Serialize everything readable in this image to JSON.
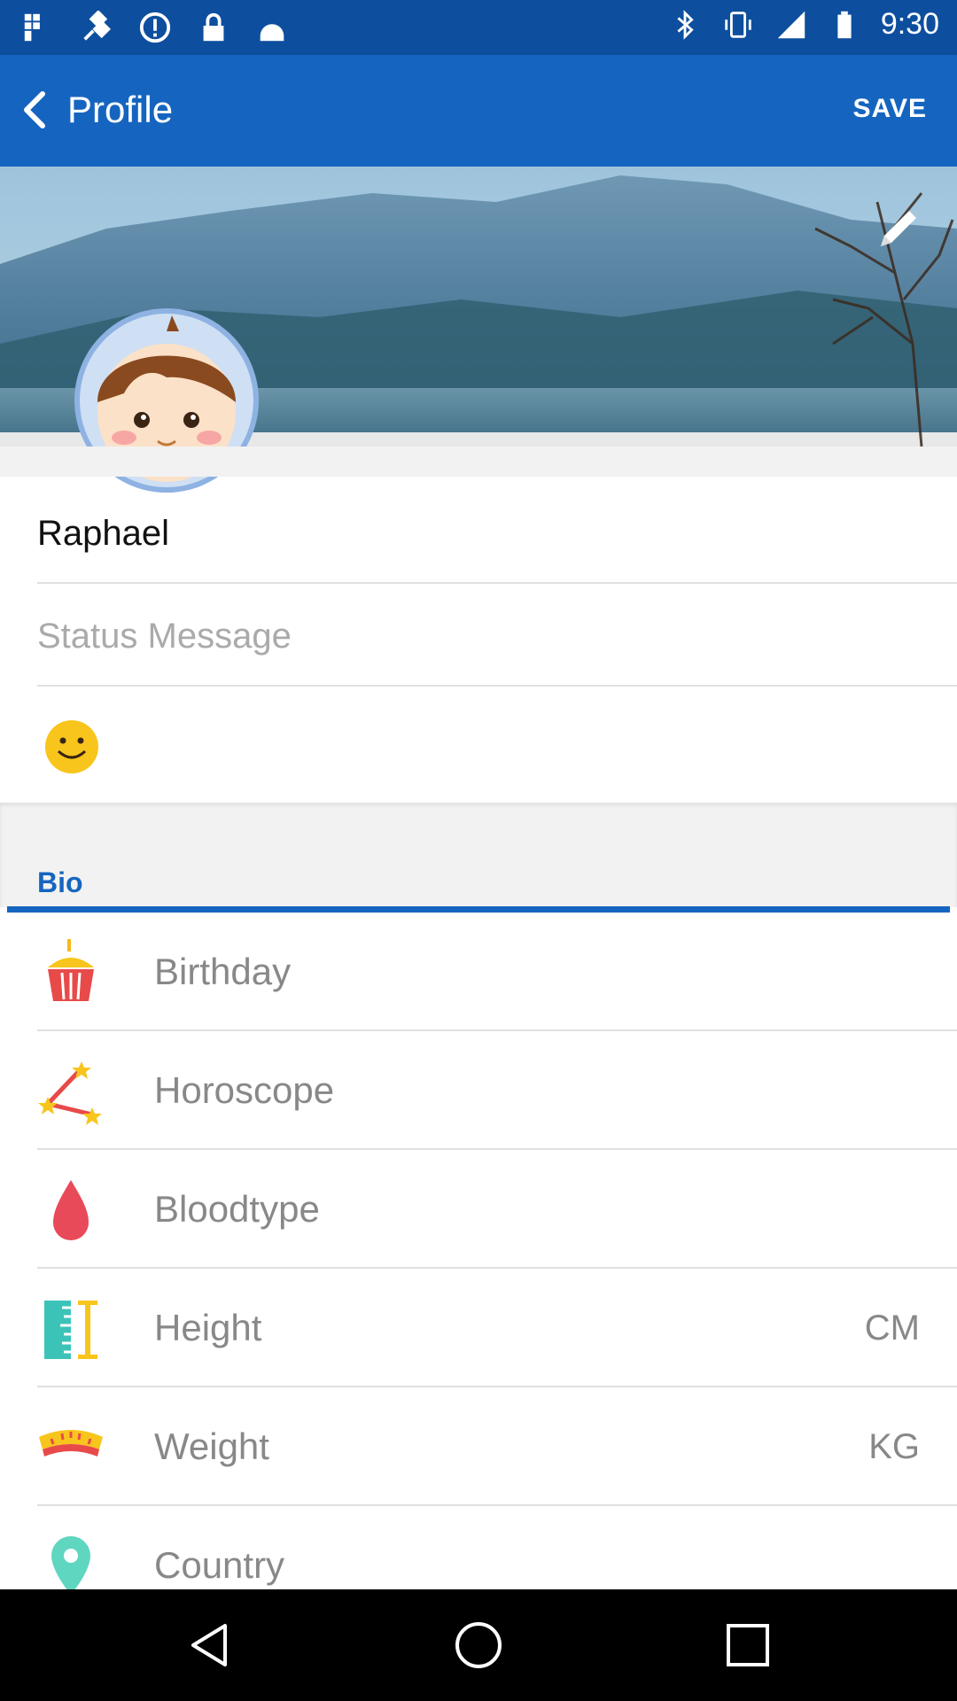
{
  "status_bar": {
    "time": "9:30"
  },
  "app_bar": {
    "title": "Profile",
    "save_label": "SAVE"
  },
  "profile": {
    "name": "Raphael",
    "status_placeholder": "Status Message"
  },
  "bio": {
    "section_label": "Bio",
    "rows": [
      {
        "label": "Birthday",
        "unit": "",
        "icon": "cupcake-icon"
      },
      {
        "label": "Horoscope",
        "unit": "",
        "icon": "constellation-icon"
      },
      {
        "label": "Bloodtype",
        "unit": "",
        "icon": "blood-drop-icon"
      },
      {
        "label": "Height",
        "unit": "CM",
        "icon": "ruler-icon"
      },
      {
        "label": "Weight",
        "unit": "KG",
        "icon": "scale-icon"
      },
      {
        "label": "Country",
        "unit": "",
        "icon": "location-pin-icon"
      }
    ]
  },
  "colors": {
    "primary": "#1565c0",
    "status_bar": "#0d4f9e"
  }
}
